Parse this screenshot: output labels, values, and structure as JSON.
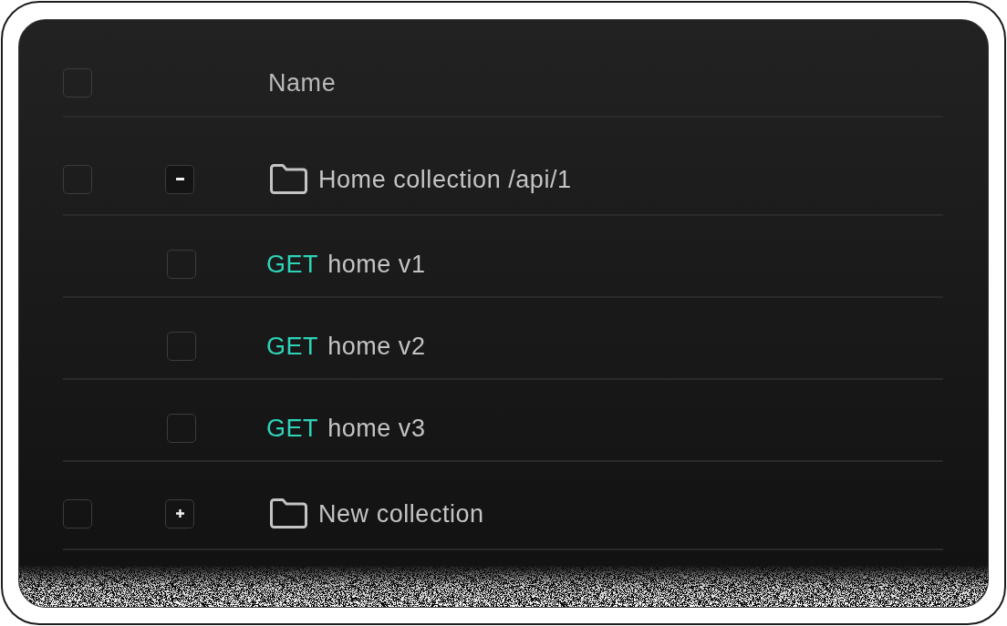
{
  "header": {
    "select_all": {
      "checked": false
    },
    "column": "Name"
  },
  "tree": [
    {
      "kind": "collection",
      "name": "Home collection /api/1",
      "checked": false,
      "expanded": true,
      "children": [
        {
          "kind": "request",
          "method": "GET",
          "name": "home v1",
          "checked": false
        },
        {
          "kind": "request",
          "method": "GET",
          "name": "home v2",
          "checked": false
        },
        {
          "kind": "request",
          "method": "GET",
          "name": "home v3",
          "checked": false
        }
      ]
    },
    {
      "kind": "collection",
      "name": "New collection",
      "checked": false,
      "expanded": false
    }
  ]
}
